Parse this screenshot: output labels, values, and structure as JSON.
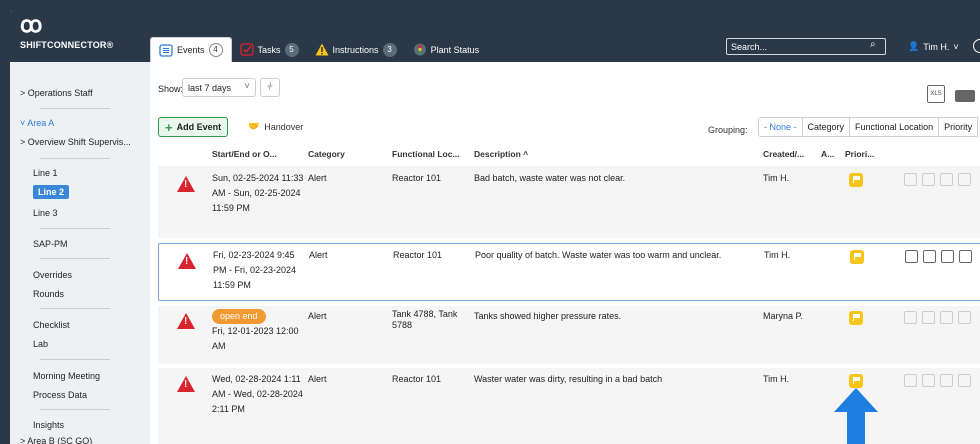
{
  "app": {
    "logo_mark": "ꝏ",
    "logo_text": "SHIFTCONNECTOR®"
  },
  "tabs": [
    {
      "label": "Events",
      "count": "4",
      "icon": "events-icon",
      "color": "#2e7bd6"
    },
    {
      "label": "Tasks",
      "count": "5",
      "icon": "tasks-icon",
      "color": "#d9232e"
    },
    {
      "label": "Instructions",
      "count": "3",
      "icon": "warning-icon",
      "color": "#f5c518"
    },
    {
      "label": "Plant Status",
      "count": "",
      "icon": "traffic-light-icon",
      "color": "#d9232e"
    }
  ],
  "search": {
    "placeholder": "Search..."
  },
  "user": {
    "name": "Tim H."
  },
  "sidebar": {
    "items": [
      {
        "label": "> Operations Staff"
      },
      {
        "label": "˅ Area A"
      },
      {
        "label": "> Overview Shift Supervis..."
      },
      {
        "label": "Line 1"
      },
      {
        "label": "Line 2"
      },
      {
        "label": "Line 3"
      },
      {
        "label": "SAP-PM"
      },
      {
        "label": "Overrides"
      },
      {
        "label": "Rounds"
      },
      {
        "label": "Checklist"
      },
      {
        "label": "Lab"
      },
      {
        "label": "Morning Meeting"
      },
      {
        "label": "Process Data"
      },
      {
        "label": "Insights"
      },
      {
        "label": "> Area B (SC GO)"
      }
    ]
  },
  "toolbar": {
    "show_label": "Show:",
    "show_value": "last 7 days",
    "add_event": "Add Event",
    "handover": "Handover",
    "grouping_label": "Grouping:",
    "grouping_options": [
      "- None -",
      "Category",
      "Functional Location",
      "Priority"
    ],
    "xls_label": "XLS"
  },
  "table": {
    "headers": [
      "Start/End or O...",
      "Category",
      "Functional Loc...",
      "Description ^",
      "Created/...",
      "A...",
      "Priori..."
    ],
    "rows": [
      {
        "start": "Sun, 02-25-2024 11:33 AM - Sun, 02-25-2024 11:59 PM",
        "badge": "",
        "category": "Alert",
        "location": "Reactor 101",
        "description": "Bad batch, waste water was not clear.",
        "created": "Tim H."
      },
      {
        "start": "Fri, 02-23-2024 9:45 PM - Fri, 02-23-2024 11:59 PM",
        "badge": "",
        "category": "Alert",
        "location": "Reactor 101",
        "description": "Poor quality of batch.  Waste water was too warm and unclear.",
        "created": "Tim H."
      },
      {
        "start": "Fri, 12-01-2023 12:00 AM",
        "badge": "open end",
        "category": "Alert",
        "location": "Tank 4788, Tank 5788",
        "description": "Tanks showed higher pressure rates.",
        "created": "Maryna P."
      },
      {
        "start": "Wed, 02-28-2024 1:11 AM - Wed, 02-28-2024 2:11 PM",
        "badge": "",
        "category": "Alert",
        "location": "Reactor 101",
        "description": "Waster water was dirty, resulting in a bad batch",
        "created": "Tim H."
      }
    ]
  },
  "colors": {
    "topbar": "#2a3847",
    "accent": "#3a86d8",
    "alert": "#d9232e",
    "priority": "#f5c518",
    "arrow": "#1f7fe0"
  }
}
